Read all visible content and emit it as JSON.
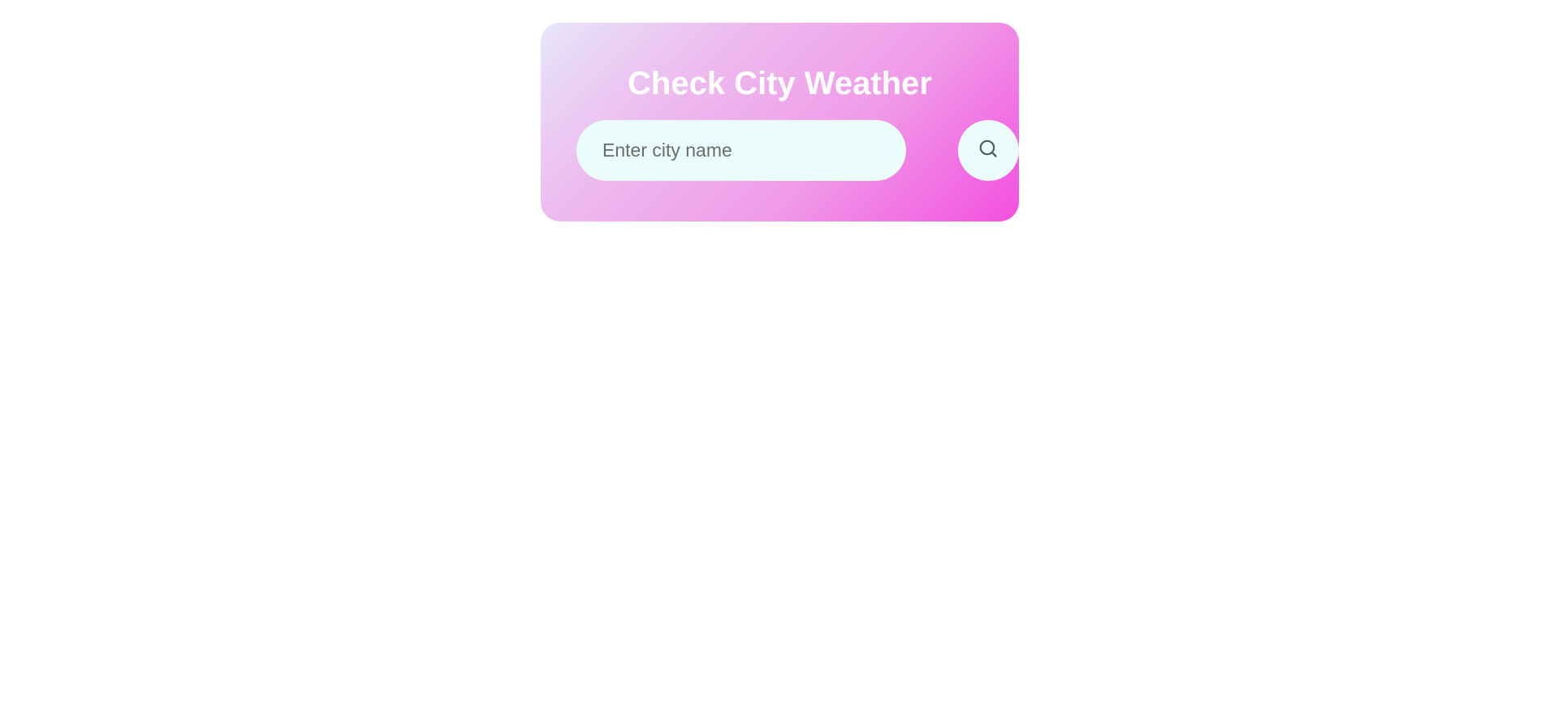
{
  "card": {
    "title": "Check City Weather"
  },
  "search": {
    "placeholder": "Enter city name",
    "value": "",
    "button_icon": "search-icon"
  },
  "colors": {
    "card_gradient_start": "#e6e6f8",
    "card_gradient_end": "#f34fe0",
    "input_background": "#eafdfa",
    "title_text": "#ffffff"
  }
}
